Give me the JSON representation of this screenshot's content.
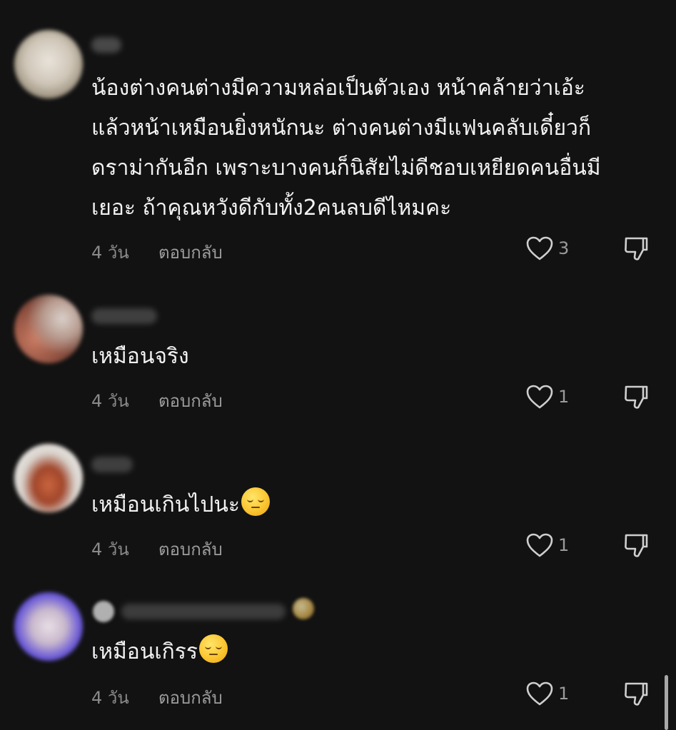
{
  "comments": [
    {
      "text": "น้องต่างคนต่างมีความหล่อเป็นตัวเอง หน้าคล้ายว่าเอ้ะ\nแล้วหน้าเหมือนยิ่งหนักนะ ต่างคนต่างมีแฟนคลับเดี๋ยวก็\nดราม่ากันอีก เพราะบางคนก็นิสัยไม่ดีชอบเหยียดคนอื่นมี\nเยอะ ถ้าคุณหวังดีกับทั้ง2คนลบดีไหมคะ",
      "time": "4 วัน",
      "reply_label": "ตอบกลับ",
      "likes": "3",
      "like_icon": "heart-outline-icon",
      "dislike_icon": "thumbs-down-icon"
    },
    {
      "text": "เหมือนจริง",
      "time": "4 วัน",
      "reply_label": "ตอบกลับ",
      "likes": "1",
      "like_icon": "heart-outline-icon",
      "dislike_icon": "thumbs-down-icon"
    },
    {
      "text": "เหมือนเกินไปนะ",
      "emoji": "pensive-face-emoji",
      "time": "4 วัน",
      "reply_label": "ตอบกลับ",
      "likes": "1",
      "like_icon": "heart-outline-icon",
      "dislike_icon": "thumbs-down-icon"
    },
    {
      "text": "เหมือนเกิรร",
      "emoji": "pensive-face-emoji",
      "time": "4 วัน",
      "reply_label": "ตอบกลับ",
      "likes": "1",
      "like_icon": "heart-outline-icon",
      "dislike_icon": "thumbs-down-icon"
    }
  ],
  "colors": {
    "background": "#121212",
    "text": "#f2f2f2",
    "meta": "#8a8a8a",
    "icon": "#cfcfcf"
  }
}
